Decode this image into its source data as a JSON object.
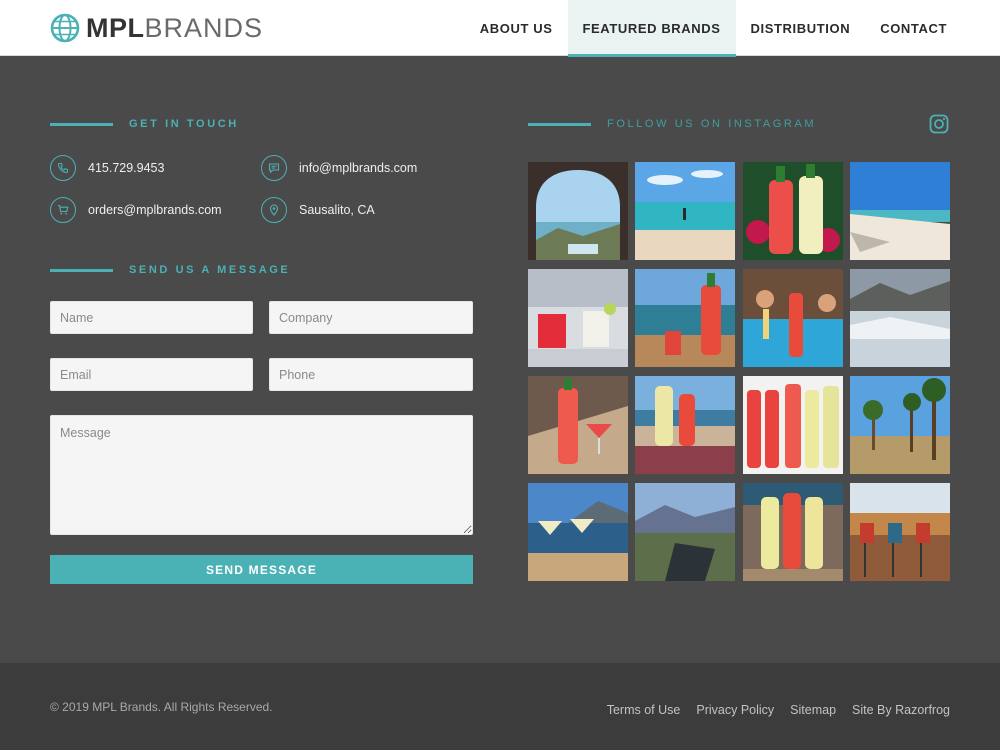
{
  "header": {
    "logo_bold": "MPL",
    "logo_light": "BRANDS",
    "nav": [
      {
        "label": "ABOUT US",
        "active": false
      },
      {
        "label": "FEATURED BRANDS",
        "active": true
      },
      {
        "label": "DISTRIBUTION",
        "active": false
      },
      {
        "label": "CONTACT",
        "active": false
      }
    ]
  },
  "contact": {
    "title": "GET IN TOUCH",
    "phone": "415.729.9453",
    "email": "info@mplbrands.com",
    "orders": "orders@mplbrands.com",
    "location": "Sausalito, CA"
  },
  "form": {
    "title": "SEND US A MESSAGE",
    "name_placeholder": "Name",
    "company_placeholder": "Company",
    "email_placeholder": "Email",
    "phone_placeholder": "Phone",
    "message_placeholder": "Message",
    "submit_label": "SEND MESSAGE"
  },
  "instagram": {
    "title": "FOLLOW US ON INSTAGRAM",
    "icon": "instagram-icon",
    "photo_count": 16
  },
  "footer": {
    "copyright": "© 2019 MPL Brands. All Rights Reserved.",
    "links": [
      "Terms of Use",
      "Privacy Policy",
      "Sitemap",
      "Site By Razorfrog"
    ]
  },
  "colors": {
    "accent": "#4ab1b5",
    "body_bg": "#4a4a4a",
    "footer_bg": "#3c3c3c",
    "header_bg": "#ffffff"
  }
}
